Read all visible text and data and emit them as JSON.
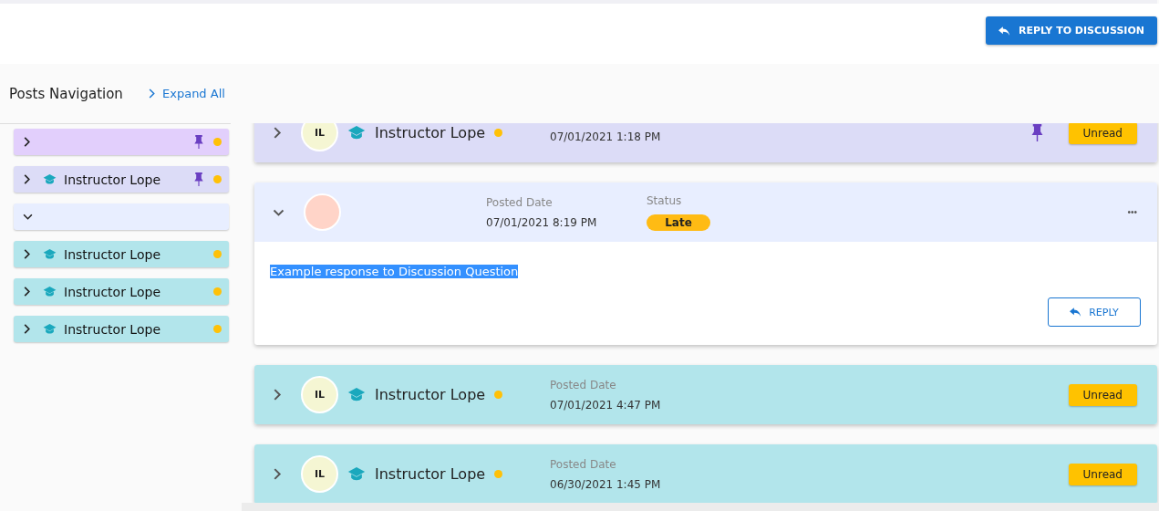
{
  "header": {
    "reply_button": "REPLY TO DISCUSSION"
  },
  "sidebar": {
    "title": "Posts Navigation",
    "expand_all": "Expand All",
    "items": [
      {
        "expanded": false,
        "instructor": false,
        "pinned": true,
        "unread": true,
        "color": "#e2cffc"
      },
      {
        "expanded": false,
        "instructor": true,
        "name": "Instructor Lope",
        "pinned": true,
        "unread": true,
        "color": "#dcdcf7"
      },
      {
        "expanded": true,
        "instructor": false,
        "pinned": false,
        "unread": false,
        "color": "#e8eeff"
      },
      {
        "expanded": false,
        "instructor": true,
        "name": "Instructor Lope",
        "pinned": false,
        "unread": true,
        "color": "#b2e5eb"
      },
      {
        "expanded": false,
        "instructor": true,
        "name": "Instructor Lope",
        "pinned": false,
        "unread": true,
        "color": "#b2e5eb"
      },
      {
        "expanded": false,
        "instructor": true,
        "name": "Instructor Lope",
        "pinned": false,
        "unread": true,
        "color": "#b2e5eb"
      }
    ]
  },
  "posts": [
    {
      "expanded": false,
      "initials": "IL",
      "instructor": true,
      "name": "Instructor Lope",
      "unread": true,
      "posted_date": "07/01/2021 1:18 PM",
      "pinned": true,
      "badge": "Unread",
      "color": "#dcdcf7"
    },
    {
      "expanded": true,
      "instructor": false,
      "unread": false,
      "posted_label": "Posted Date",
      "posted_date": "07/01/2021 8:19 PM",
      "status_label": "Status",
      "status": "Late",
      "pinned": false,
      "more": "•••",
      "color": "#e8eeff",
      "body": "Example response to Discussion Question",
      "body_selected": true,
      "reply": "REPLY"
    },
    {
      "expanded": false,
      "initials": "IL",
      "instructor": true,
      "name": "Instructor Lope",
      "unread": true,
      "posted_label": "Posted Date",
      "posted_date": "07/01/2021 4:47 PM",
      "pinned": false,
      "badge": "Unread",
      "color": "#b2e5eb"
    },
    {
      "expanded": false,
      "initials": "IL",
      "instructor": true,
      "name": "Instructor Lope",
      "unread": true,
      "posted_label": "Posted Date",
      "posted_date": "06/30/2021 1:45 PM",
      "pinned": false,
      "badge": "Unread",
      "color": "#b2e5eb"
    }
  ]
}
